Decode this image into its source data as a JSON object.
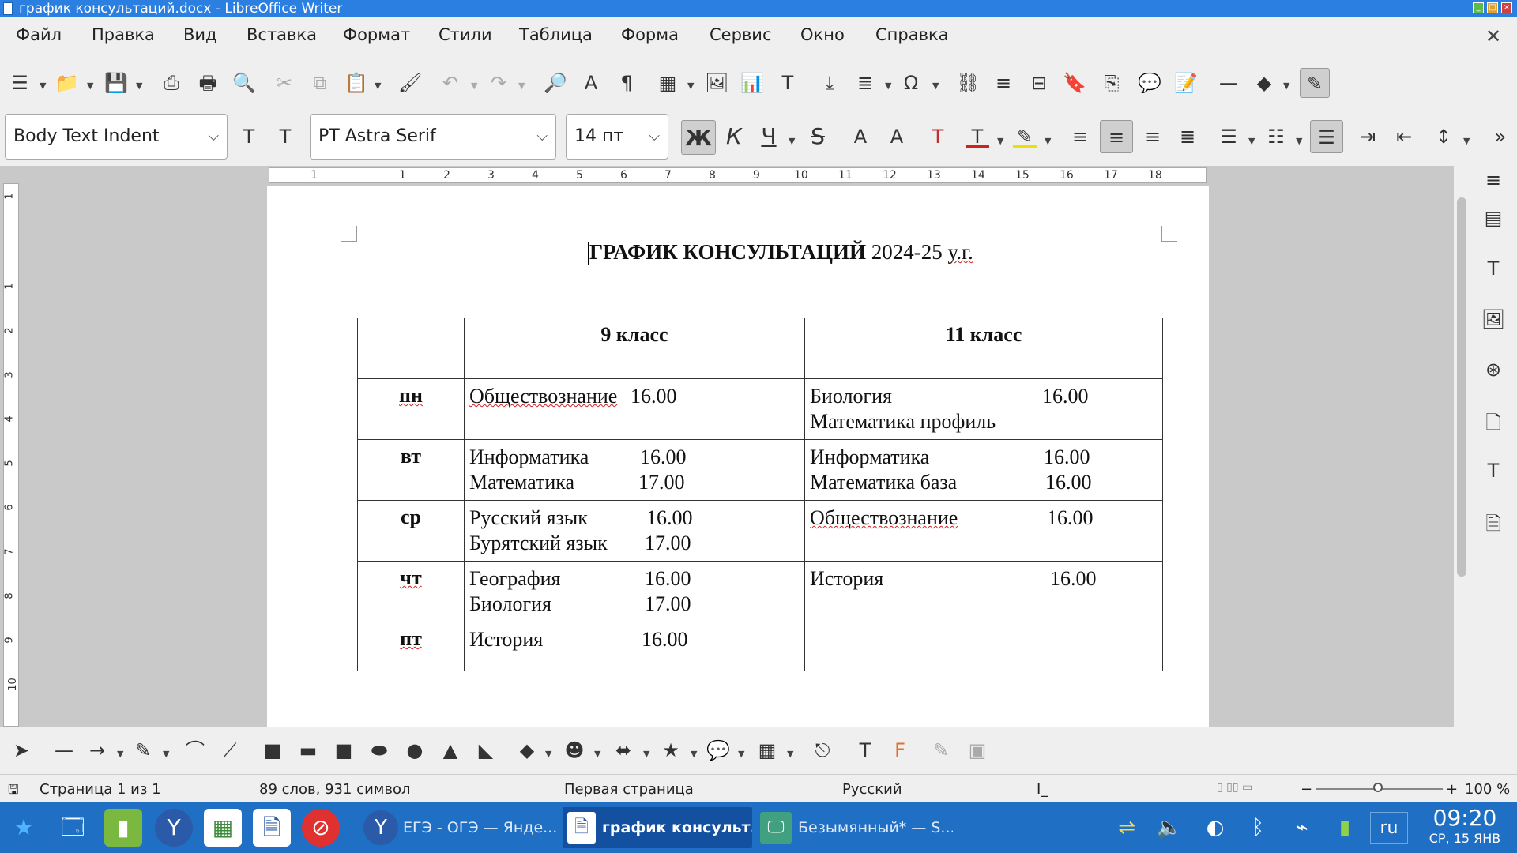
{
  "window": {
    "title": "график консультаций.docx - LibreOffice Writer"
  },
  "menu": [
    "Файл",
    "Правка",
    "Вид",
    "Вставка",
    "Формат",
    "Стили",
    "Таблица",
    "Форма",
    "Сервис",
    "Окно",
    "Справка"
  ],
  "toolbar2": {
    "paragraph_style": "Body Text Indent",
    "font_name": "PT Astra Serif",
    "font_size": "14 пт",
    "bold": "Ж",
    "italic": "К",
    "underline": "Ч",
    "strike": "S"
  },
  "ruler": {
    "h_numbers": [
      "1",
      "1",
      "2",
      "3",
      "4",
      "5",
      "6",
      "7",
      "8",
      "9",
      "10",
      "11",
      "12",
      "13",
      "14",
      "15",
      "16",
      "17",
      "18"
    ],
    "v_numbers": [
      "1",
      "1",
      "2",
      "3",
      "4",
      "5",
      "6",
      "7",
      "8",
      "9",
      "10"
    ]
  },
  "document": {
    "title_bold": "ГРАФИК КОНСУЛЬТАЦИЙ",
    "title_rest": " 2024-25 ",
    "title_suffix": "у.г.",
    "table": {
      "headers": [
        "",
        "9 класс",
        "11 класс"
      ],
      "rows": [
        {
          "day": "пн",
          "c9": [
            {
              "s": "Обществознание",
              "t": "16.00"
            }
          ],
          "c11": [
            {
              "s": "Биология",
              "t": "16.00"
            },
            {
              "s": "Математика профиль",
              "t": ""
            }
          ]
        },
        {
          "day": "вт",
          "c9": [
            {
              "s": "Информатика",
              "t": "16.00"
            },
            {
              "s": "Математика",
              "t": "17.00"
            }
          ],
          "c11": [
            {
              "s": "Информатика",
              "t": "16.00"
            },
            {
              "s": "Математика база",
              "t": "16.00"
            }
          ]
        },
        {
          "day": "ср",
          "c9": [
            {
              "s": "Русский язык",
              "t": "16.00"
            },
            {
              "s": "Бурятский язык",
              "t": "17.00"
            }
          ],
          "c11": [
            {
              "s": "Обществознание",
              "t": "16.00"
            }
          ]
        },
        {
          "day": "чт",
          "c9": [
            {
              "s": "География",
              "t": "16.00"
            },
            {
              "s": "Биология",
              "t": "17.00"
            }
          ],
          "c11": [
            {
              "s": "История",
              "t": "16.00"
            }
          ]
        },
        {
          "day": "пт",
          "c9": [
            {
              "s": "История",
              "t": "16.00"
            }
          ],
          "c11": []
        }
      ]
    }
  },
  "status": {
    "page": "Страница 1 из 1",
    "words": "89 слов, 931 символ",
    "page_style": "Первая страница",
    "language": "Русский",
    "zoom": "100 %"
  },
  "taskbar": {
    "tasks": [
      "ЕГЭ - ОГЭ — Янде...",
      "график консульт...",
      "Безымянный* — S..."
    ],
    "lang": "ru",
    "time": "09:20",
    "date": "СР, 15 ЯНВ"
  }
}
